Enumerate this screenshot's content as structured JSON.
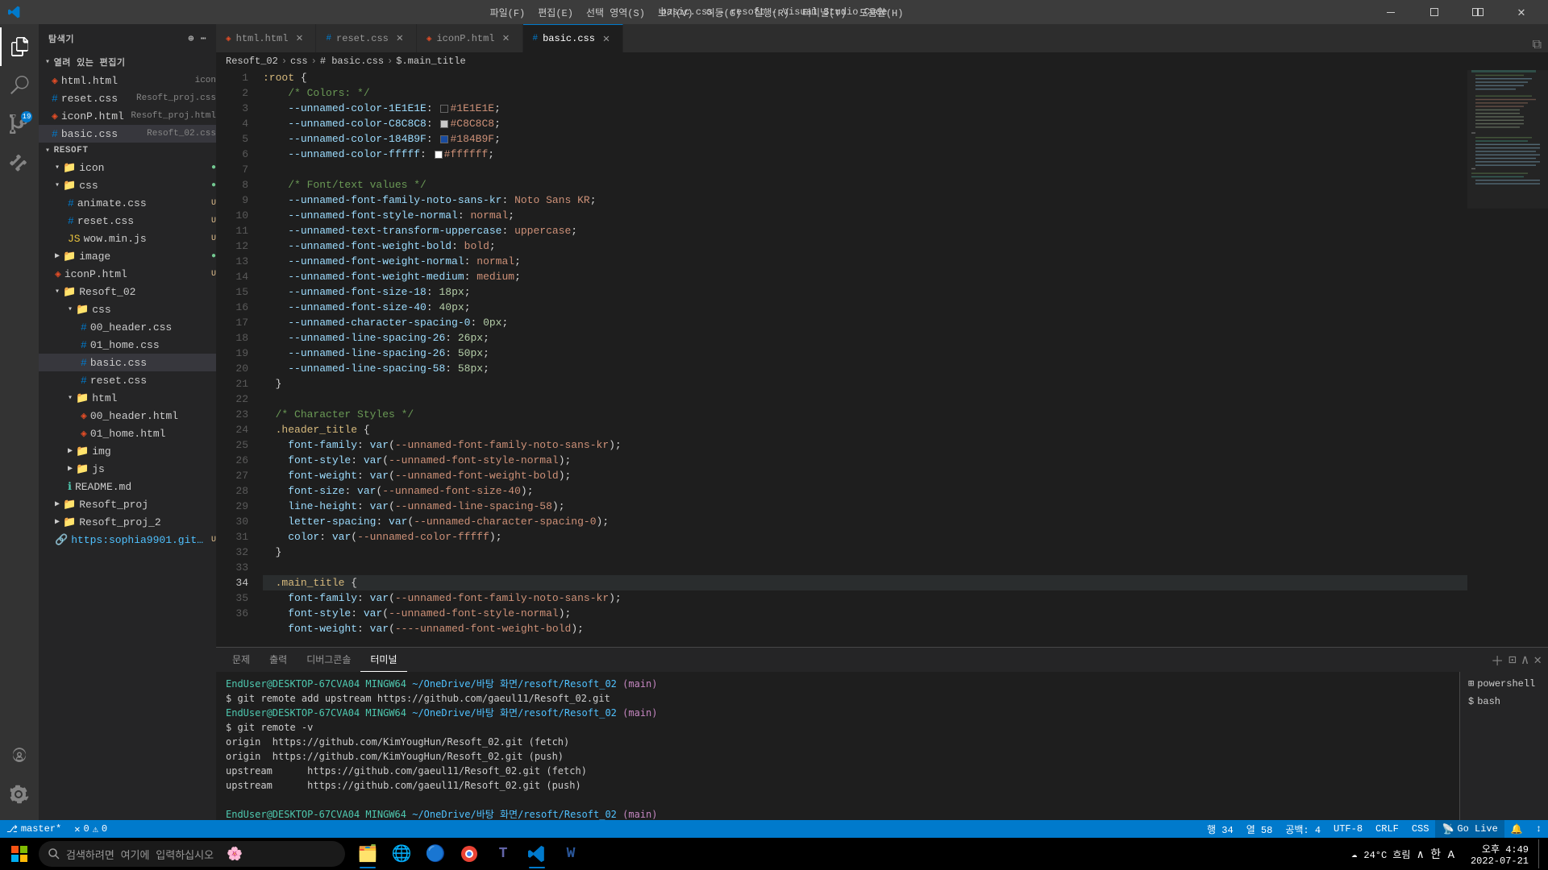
{
  "titleBar": {
    "title": "basic.css - resoft - Visual Studio Code",
    "menu": [
      "파일(F)",
      "편집(E)",
      "선택 영역(S)",
      "보기(V)",
      "이동(G)",
      "실행(R)",
      "터미널(T)",
      "도움말(H)"
    ],
    "controls": [
      "─",
      "□",
      "✕"
    ]
  },
  "activityBar": {
    "icons": [
      "explorer",
      "search",
      "git",
      "extensions",
      "account",
      "settings"
    ],
    "gitBadge": "19"
  },
  "sidebar": {
    "header": "탐색기",
    "openEditors": "열려 있는 편집기",
    "openFiles": [
      {
        "name": "html.html",
        "icon": "icon",
        "path": "",
        "indent": 8
      },
      {
        "name": "reset.css",
        "info": "Resoft_proj.css",
        "indent": 8
      },
      {
        "name": "iconP.html",
        "info": "Resoft_proj.html",
        "indent": 8
      },
      {
        "name": "basic.css",
        "info": "Resoft_02.css",
        "indent": 8,
        "active": true
      }
    ],
    "resoft": {
      "name": "RESOFT",
      "icon_folder": "icon",
      "css_folder": "css",
      "cssFiles": [
        "animate.css",
        "reset.css",
        "wow.min.js"
      ],
      "cssFileBadges": [
        "U",
        "U",
        "U"
      ],
      "image_folder": "image",
      "iconP_html": "iconP.html",
      "resoftProj": "Resoft_02",
      "resoftProjCss": {
        "name": "css",
        "files": [
          "00_header.css",
          "01_home.css",
          "basic.css",
          "reset.css"
        ]
      },
      "resoftProjHtml": {
        "name": "html",
        "files": [
          "00_header.html",
          "01_home.html"
        ]
      },
      "img_folder": "img",
      "js_folder": "js",
      "readme": "README.md",
      "resoftProj2": "Resoft_proj",
      "resoftProj3": "Resoft_proj_2",
      "websiteLink": "https://sophia9901.github.ioResof..."
    }
  },
  "tabs": [
    {
      "name": "html.html",
      "color": "#e44d26",
      "active": false
    },
    {
      "name": "reset.css",
      "color": "#007acc",
      "active": false
    },
    {
      "name": "iconP.html",
      "color": "#e44d26",
      "active": false
    },
    {
      "name": "basic.css",
      "color": "#007acc",
      "active": true
    }
  ],
  "breadcrumb": [
    "Resoft_02",
    ">",
    "css",
    ">",
    "# basic.css",
    ">",
    "$.main_title"
  ],
  "code": {
    "filename": "basic.css",
    "lines": [
      "  :root {",
      "    /* Colors: */",
      "    --unnamed-color-1E1E1E: ▪#1E1E1E;",
      "    --unnamed-color-C8C8C8: ▪#C8C8C8;",
      "    --unnamed-color-184B9F: ▪#184B9F;",
      "    --unnamed-color-fffff: ▪#ffffff;",
      "    ",
      "    /* Font/text values */",
      "    --unnamed-font-family-noto-sans-kr: Noto Sans KR;",
      "    --unnamed-font-style-normal: normal;",
      "    --unnamed-text-transform-uppercase: uppercase;",
      "    --unnamed-font-weight-bold: bold;",
      "    --unnamed-font-weight-normal: normal;",
      "    --unnamed-font-weight-medium: medium;",
      "    --unnamed-font-size-18: 18px;",
      "    --unnamed-font-size-40: 40px;",
      "    --unnamed-character-spacing-0: 0px;",
      "    --unnamed-line-spacing-26: 26px;",
      "    --unnamed-line-spacing-26: 50px;",
      "    --unnamed-line-spacing-58: 58px;",
      "  }",
      "  ",
      "  /* Character Styles */",
      "  .header_title {",
      "    font-family: var(--unnamed-font-family-noto-sans-kr);",
      "    font-style: var(--unnamed-font-style-normal);",
      "    font-weight: var(--unnamed-font-weight-bold);",
      "    font-size: var(--unnamed-font-size-40);",
      "    line-height: var(--unnamed-line-spacing-58);",
      "    letter-spacing: var(--unnamed-character-spacing-0);",
      "    color: var(--unnamed-color-fffff);",
      "  }",
      "  ",
      "  .main_title {",
      "    font-family: var(--unnamed-font-family-noto-sans-kr);",
      "    font-style: var(--unnamed-font-style-normal);",
      "    font-weight: var(----unnamed-font-weight-bold);"
    ],
    "activeLineNum": 34
  },
  "terminal": {
    "tabs": [
      "문제",
      "출력",
      "디버그콘솔",
      "터미널"
    ],
    "activeTab": "터미널",
    "shells": [
      "powershell",
      "bash"
    ],
    "lines": [
      {
        "user": "EndUser@DESKTOP-67CVA04",
        "shell": "MINGW64",
        "path": "~/OneDrive/바탕 화면/resoft/Resoft_02",
        "branch": "(main)"
      },
      {
        "cmd": "$ git remote add upstream https://github.com/gaeul11/Resoft_02.git"
      },
      {
        "user": "EndUser@DESKTOP-67CVA04",
        "shell": "MINGW64",
        "path": "~/OneDrive/바탕 화면/resoft/Resoft_02",
        "branch": "(main)"
      },
      {
        "cmd": "$ git remote -v"
      },
      {
        "plain": "origin\thttps://github.com/KimYougHun/Resoft_02.git (fetch)"
      },
      {
        "plain": "origin\thttps://github.com/KimYougHun/Resoft_02.git (push)"
      },
      {
        "plain": "upstream\t\thttps://github.com/gaeul11/Resoft_02.git (fetch)"
      },
      {
        "plain": "upstream\t\thttps://github.com/gaeul11/Resoft_02.git (push)"
      },
      {
        "empty": true
      },
      {
        "user": "EndUser@DESKTOP-67CVA04",
        "shell": "MINGW64",
        "path": "~/OneDrive/바탕 화면/resoft/Resoft_02",
        "branch": "(main)"
      },
      {
        "cmd": "$",
        "cursor": true
      }
    ]
  },
  "statusBar": {
    "branch": "master*",
    "errors": "0",
    "warnings": "0",
    "goLive": "Go Live",
    "line": "행 34",
    "col": "열 58",
    "spaces": "공백: 4",
    "encoding": "UTF-8",
    "lineEnding": "CRLF",
    "language": "CSS",
    "bell": "🔔",
    "sync": "↕"
  },
  "taskbar": {
    "searchPlaceholder": "검색하려면 여기에 입력하십시오",
    "clock": "오후 4:49",
    "date": "2022-07-21",
    "weather": "24°C 흐림"
  }
}
